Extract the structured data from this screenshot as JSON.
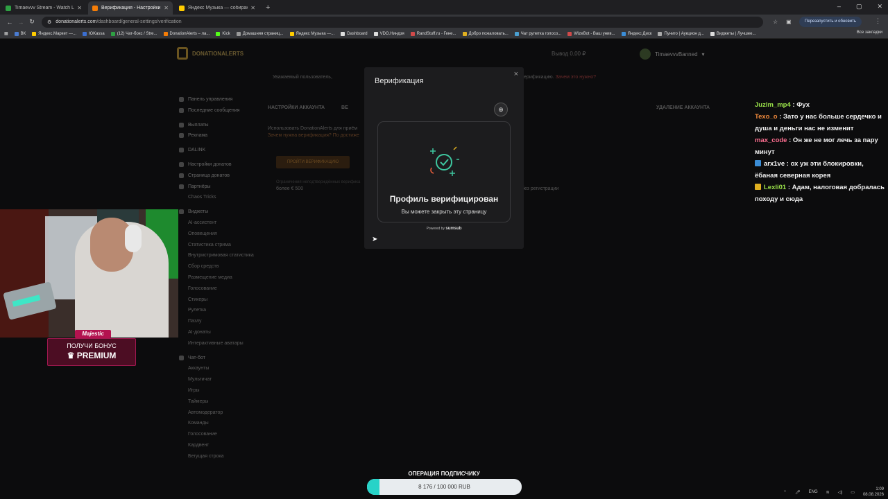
{
  "browser": {
    "tabs": [
      {
        "label": "Timaevvv Stream - Watch Live o",
        "active": false,
        "color": "#2ea043"
      },
      {
        "label": "Верификация - Настройки акк",
        "active": true,
        "color": "#f57d07"
      },
      {
        "label": "Яндекс Музыка — собирают",
        "active": false,
        "color": "#ffcc00"
      }
    ],
    "url_host": "donationalerts.com",
    "url_path": "/dashboard/general-settings/verification",
    "relaunch_label": "Перезапустить и обновить",
    "bookmarks": [
      "ВК",
      "Яндекс.Маркет —...",
      "ЮKassa",
      "(12) Чат-бокс / Stre...",
      "DonationAlerts – ла...",
      "Kick",
      "Домашняя страниц...",
      "Яндекс Музыка —...",
      "Dashboard",
      "VDO.Ниндзя",
      "RandStuff.ru - Гене...",
      "Добро пожаловать...",
      "Чат рулетка голосо...",
      "WizeBot - Ваш унив...",
      "Яндекс Диск",
      "Пуниго | Аукцион д...",
      "Виджеты | Лучшее..."
    ],
    "all_bookmarks": "Все закладки"
  },
  "site": {
    "logo": "DONATIONALERTS",
    "balance": "Вывод  0,00 ₽",
    "username": "TimaevvvBanned",
    "notice": "Уважаемый пользователь,",
    "notice_tail": "пройти верификацию.",
    "notice_link": "Зачем это нужно?",
    "sidebar": [
      {
        "label": "Панель управления",
        "main": true
      },
      {
        "label": "Последние сообщения",
        "main": true
      },
      {
        "label": "Выплаты",
        "main": true,
        "gap": true
      },
      {
        "label": "Реклама",
        "main": true
      },
      {
        "label": "DALINK",
        "main": true,
        "gap": true
      },
      {
        "label": "Настройки донатов",
        "main": true,
        "gap": true
      },
      {
        "label": "Страница донатов",
        "main": true
      },
      {
        "label": "Партнёры",
        "main": true
      },
      {
        "label": "Chaos Tricks",
        "main": false
      },
      {
        "label": "Виджеты",
        "main": true,
        "gap": true
      },
      {
        "label": "AI-ассистент",
        "main": false
      },
      {
        "label": "Оповещения",
        "main": false
      },
      {
        "label": "Статистика стрима",
        "main": false
      },
      {
        "label": "Внутристримовая статистика",
        "main": false
      },
      {
        "label": "Сбор средств",
        "main": false
      },
      {
        "label": "Размещение медиа",
        "main": false
      },
      {
        "label": "Голосование",
        "main": false
      },
      {
        "label": "Стикеры",
        "main": false
      },
      {
        "label": "Рулетка",
        "main": false
      },
      {
        "label": "Пазлу",
        "main": false
      },
      {
        "label": "AI-донаты",
        "main": false
      },
      {
        "label": "Интерактивные аватары",
        "main": false
      },
      {
        "label": "Чат-бот",
        "main": true,
        "gap": true
      },
      {
        "label": "Аккаунты",
        "main": false
      },
      {
        "label": "Мультичат",
        "main": false
      },
      {
        "label": "Игры",
        "main": false
      },
      {
        "label": "Таймеры",
        "main": false
      },
      {
        "label": "Автомодератор",
        "main": false
      },
      {
        "label": "Команды",
        "main": false
      },
      {
        "label": "Голосование",
        "main": false
      },
      {
        "label": "Кардвент",
        "main": false
      },
      {
        "label": "Бегущая строка",
        "main": false
      }
    ],
    "tab_account": "НАСТРОЙКИ АККАУНТА",
    "tab_verif": "ВЕ",
    "tab_delete": "УДАЛЕНИЕ АККАУНТА",
    "content_line1": "Использовать DonationAlerts для приём",
    "content_line2": "Зачем нужна верификация? По достиже",
    "verify_button": "ПРОЙТИ ВЕРИФИКАЦИЮ",
    "small1": "Ограничения неподтверждённых верифика",
    "small2": "более € 500",
    "small3": "без регистрации"
  },
  "modal": {
    "title": "Верификация",
    "close": "×",
    "verified_title": "Профиль верифицирован",
    "verified_sub": "Вы можете закрыть эту страницу",
    "powered_by": "Powered by",
    "powered_brand": "sumsub"
  },
  "stream": {
    "bonus_tag": "Majestic",
    "bonus_line1": "ПОЛУЧИ БОНУС",
    "bonus_line2": "♛ PREMIUM"
  },
  "chat": [
    {
      "name": "Juzlm_mp4",
      "color": "#9be34a",
      "text": " : Фух",
      "badge": ""
    },
    {
      "name": "Texo_o",
      "color": "#f08a3c",
      "text": " : Зато у нас больше сердечко и душа и деньги нас не изменит",
      "badge": ""
    },
    {
      "name": "max_code",
      "color": "#ff6f91",
      "text": " : Он же не мог лечь за пару минут",
      "badge": ""
    },
    {
      "name": "arx1ve",
      "color": "#ffffff",
      "text": " : ох уж эти блокировки, ёбаная северная корея",
      "badge": "#3b8dd6"
    },
    {
      "name": "Lexli01",
      "color": "#9be34a",
      "text": " : Адам, налоговая добралась походу и сюда",
      "badge": "#e0b020"
    }
  ],
  "goal": {
    "title": "ОПЕРАЦИЯ ПОДПИСЧИКУ",
    "text": "8 176 / 100 000 RUB",
    "progress": 0.082
  },
  "tray": {
    "lang": "ENG",
    "time": "1:09",
    "date": "08.08.2026"
  }
}
